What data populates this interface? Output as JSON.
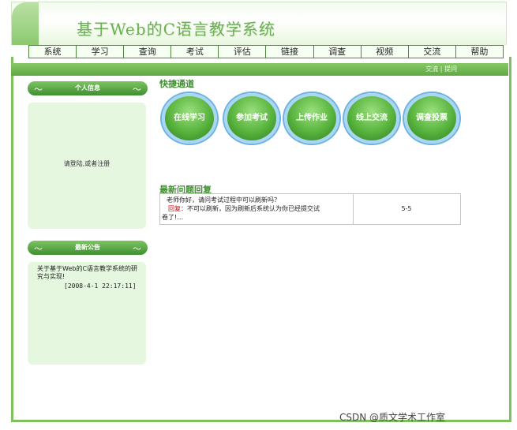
{
  "header": {
    "title": "基于Web的C语言教学系统"
  },
  "nav": {
    "items": [
      "系统",
      "学习",
      "查询",
      "考试",
      "评估",
      "链接",
      "调查",
      "视频",
      "交流",
      "帮助"
    ]
  },
  "topbar": {
    "links": "交流 | 提问"
  },
  "sidebar": {
    "personal": {
      "heading": "个人信息",
      "message": "请登陆,或者注册"
    },
    "notice": {
      "heading": "最新公告",
      "text": "关于基于Web的C语言教学系统的研究与实现!",
      "date": "[2008-4-1 22:17:11]"
    }
  },
  "quick": {
    "title": "快捷通道",
    "buttons": [
      "在线学习",
      "参加考试",
      "上传作业",
      "线上交流",
      "调查投票"
    ]
  },
  "latest": {
    "title": "最新问题回复",
    "question": "老师你好，请问考试过程中可以刷新吗？",
    "reply_label": "回复：",
    "reply_text": "不可以刷新，因为刷新后系统认为你已经提交试",
    "reply_cont": "卷了!…",
    "count": "5-5"
  },
  "watermark": "CSDN @质文学术工作室"
}
